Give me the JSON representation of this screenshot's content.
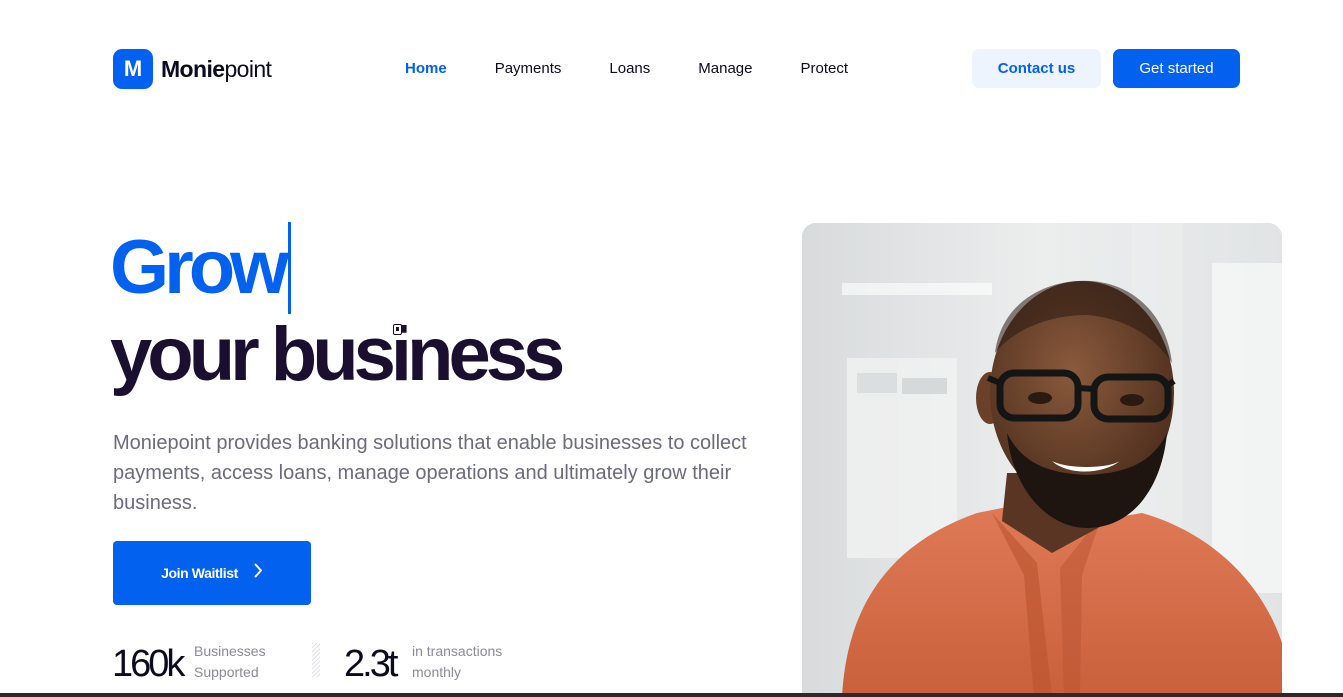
{
  "header": {
    "logo_letter": "M",
    "logo_bold": "Monie",
    "logo_light": "point",
    "nav": [
      {
        "label": "Home",
        "active": true
      },
      {
        "label": "Payments",
        "active": false
      },
      {
        "label": "Loans",
        "active": false
      },
      {
        "label": "Manage",
        "active": false
      },
      {
        "label": "Protect",
        "active": false
      }
    ],
    "contact_label": "Contact us",
    "get_started_label": "Get started"
  },
  "hero": {
    "headline_accent": "Grow",
    "headline_rest": "your business",
    "description": "Moniepoint provides banking solutions that enable businesses to collect payments, access loans, manage operations and ultimately grow their business.",
    "cta_label": "Join Waitlist",
    "cta_icon": "chevron-right-icon"
  },
  "stats": [
    {
      "value": "160k",
      "label_line1": "Businesses",
      "label_line2": "Supported"
    },
    {
      "value": "2.3t",
      "label_line1": "in transactions",
      "label_line2": "monthly"
    }
  ],
  "colors": {
    "brand": "#0361f0",
    "headline_dark": "#1a0f2e",
    "muted_text": "#6b6b7b",
    "contact_bg": "#eef4fd"
  }
}
